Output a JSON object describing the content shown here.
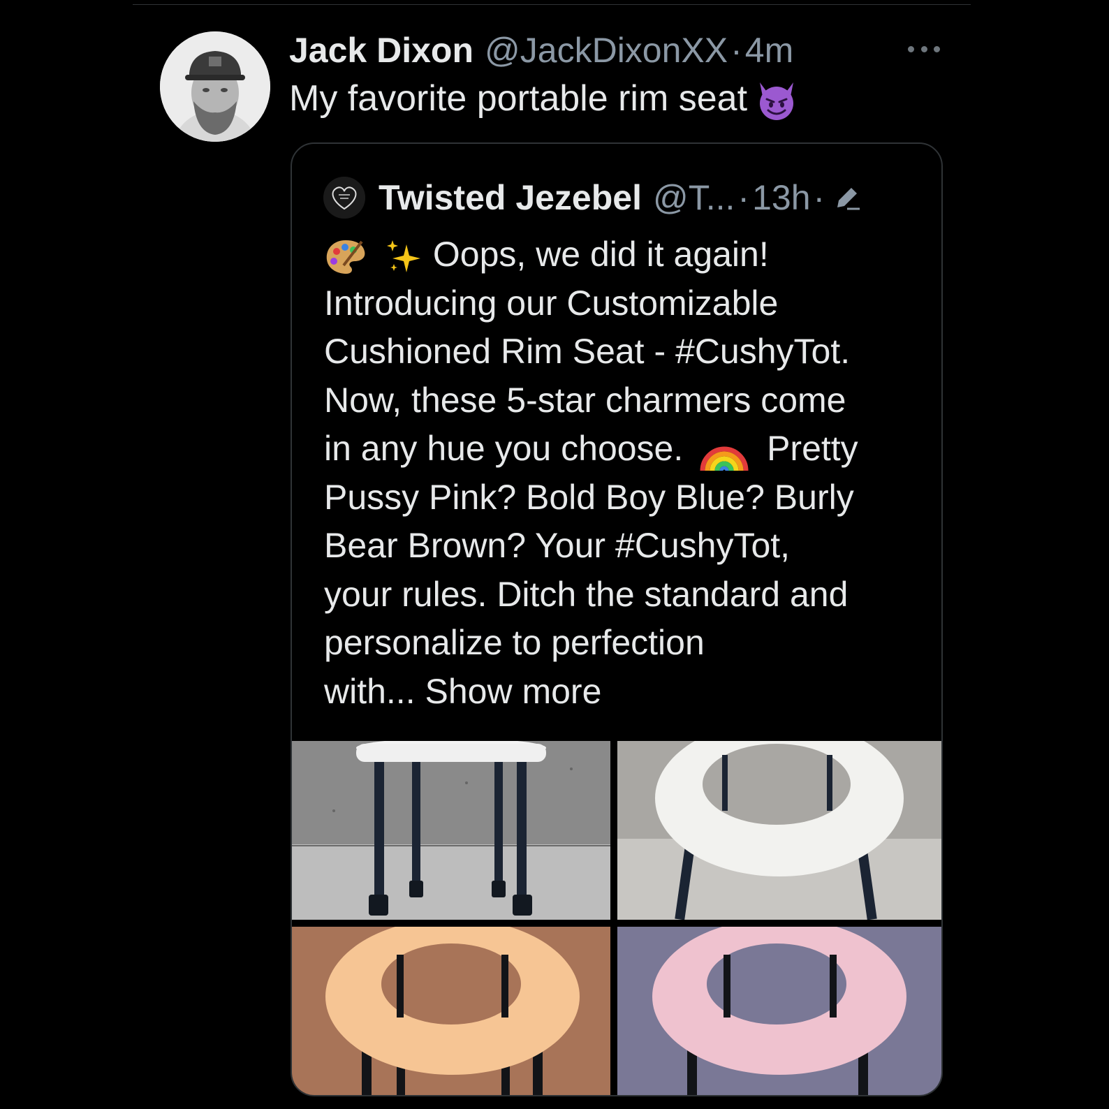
{
  "tweet": {
    "author_name": "Jack Dixon",
    "handle": "@JackDixonXX",
    "dot": "·",
    "time": "4m",
    "text": "My favorite portable rim seat",
    "emoji": "smiling-face-with-horns"
  },
  "quoted": {
    "author_name": "Twisted Jezebel",
    "handle": "@T...",
    "dot": "·",
    "time": "13h",
    "dot2": "·",
    "lines": [
      "Oops, we did it again!",
      "Introducing our Customizable",
      "Cushioned Rim Seat - #CushyTot.",
      "Now, these 5-star charmers come",
      "in any hue you choose.",
      "Pretty",
      "Pussy Pink? Bold Boy Blue? Burly",
      "Bear Brown? Your #CushyTot,",
      "your rules. Ditch the standard and",
      "personalize to perfection",
      "with..."
    ],
    "show_more": "Show more",
    "emojis": [
      "artist-palette",
      "sparkles",
      "rainbow"
    ]
  },
  "media": {
    "tiles": [
      {
        "name": "white-seat-side-view",
        "bg": "#8f8f8f"
      },
      {
        "name": "white-seat-top-view",
        "bg": "#b8b6b2"
      },
      {
        "name": "peach-seat",
        "bg": "#a87458"
      },
      {
        "name": "pink-seat",
        "bg": "#7a7896"
      }
    ]
  }
}
